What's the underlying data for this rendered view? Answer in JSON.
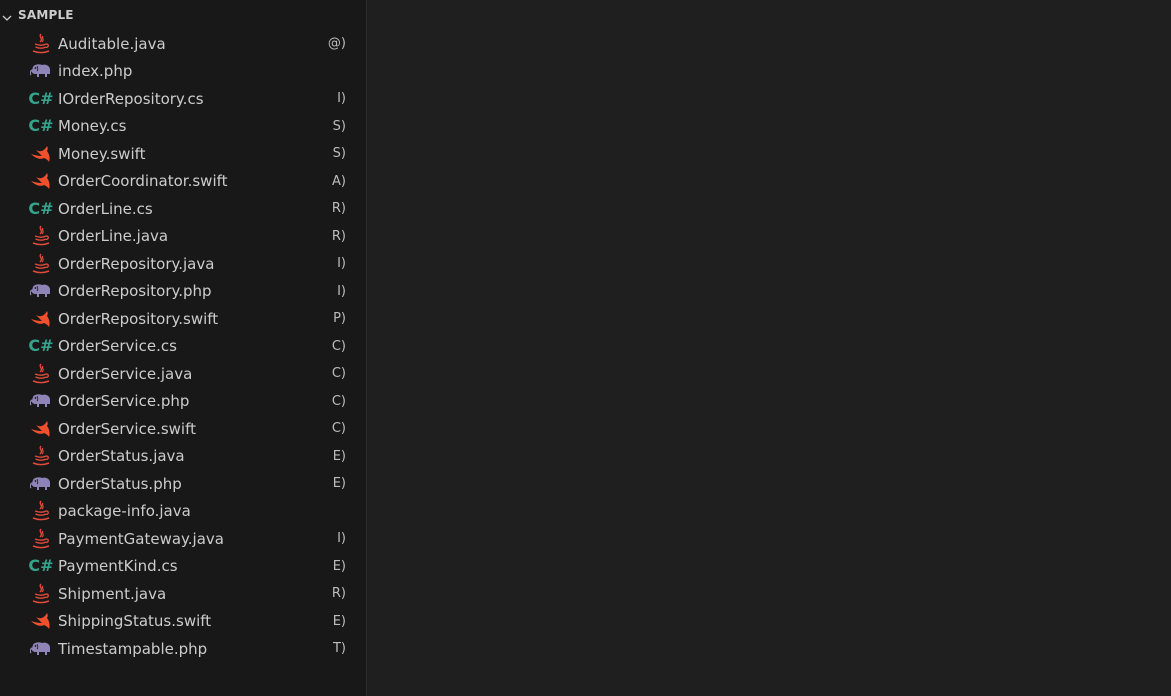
{
  "explorer": {
    "section_title": "SAMPLE"
  },
  "colors": {
    "java": "#e24b3b",
    "php": "#8f84b8",
    "csharp": "#35a38c",
    "swift": "#f0512c"
  },
  "files": [
    {
      "name": "Auditable.java",
      "kind": "@)",
      "icon": "java-icon"
    },
    {
      "name": "index.php",
      "kind": "",
      "icon": "php-icon"
    },
    {
      "name": "IOrderRepository.cs",
      "kind": "I)",
      "icon": "csharp-icon"
    },
    {
      "name": "Money.cs",
      "kind": "S)",
      "icon": "csharp-icon"
    },
    {
      "name": "Money.swift",
      "kind": "S)",
      "icon": "swift-icon"
    },
    {
      "name": "OrderCoordinator.swift",
      "kind": "A)",
      "icon": "swift-icon"
    },
    {
      "name": "OrderLine.cs",
      "kind": "R)",
      "icon": "csharp-icon"
    },
    {
      "name": "OrderLine.java",
      "kind": "R)",
      "icon": "java-icon"
    },
    {
      "name": "OrderRepository.java",
      "kind": "I)",
      "icon": "java-icon"
    },
    {
      "name": "OrderRepository.php",
      "kind": "I)",
      "icon": "php-icon"
    },
    {
      "name": "OrderRepository.swift",
      "kind": "P)",
      "icon": "swift-icon"
    },
    {
      "name": "OrderService.cs",
      "kind": "C)",
      "icon": "csharp-icon"
    },
    {
      "name": "OrderService.java",
      "kind": "C)",
      "icon": "java-icon"
    },
    {
      "name": "OrderService.php",
      "kind": "C)",
      "icon": "php-icon"
    },
    {
      "name": "OrderService.swift",
      "kind": "C)",
      "icon": "swift-icon"
    },
    {
      "name": "OrderStatus.java",
      "kind": "E)",
      "icon": "java-icon"
    },
    {
      "name": "OrderStatus.php",
      "kind": "E)",
      "icon": "php-icon"
    },
    {
      "name": "package-info.java",
      "kind": "",
      "icon": "java-icon"
    },
    {
      "name": "PaymentGateway.java",
      "kind": "I)",
      "icon": "java-icon"
    },
    {
      "name": "PaymentKind.cs",
      "kind": "E)",
      "icon": "csharp-icon"
    },
    {
      "name": "Shipment.java",
      "kind": "R)",
      "icon": "java-icon"
    },
    {
      "name": "ShippingStatus.swift",
      "kind": "E)",
      "icon": "swift-icon"
    },
    {
      "name": "Timestampable.php",
      "kind": "T)",
      "icon": "php-icon"
    }
  ]
}
